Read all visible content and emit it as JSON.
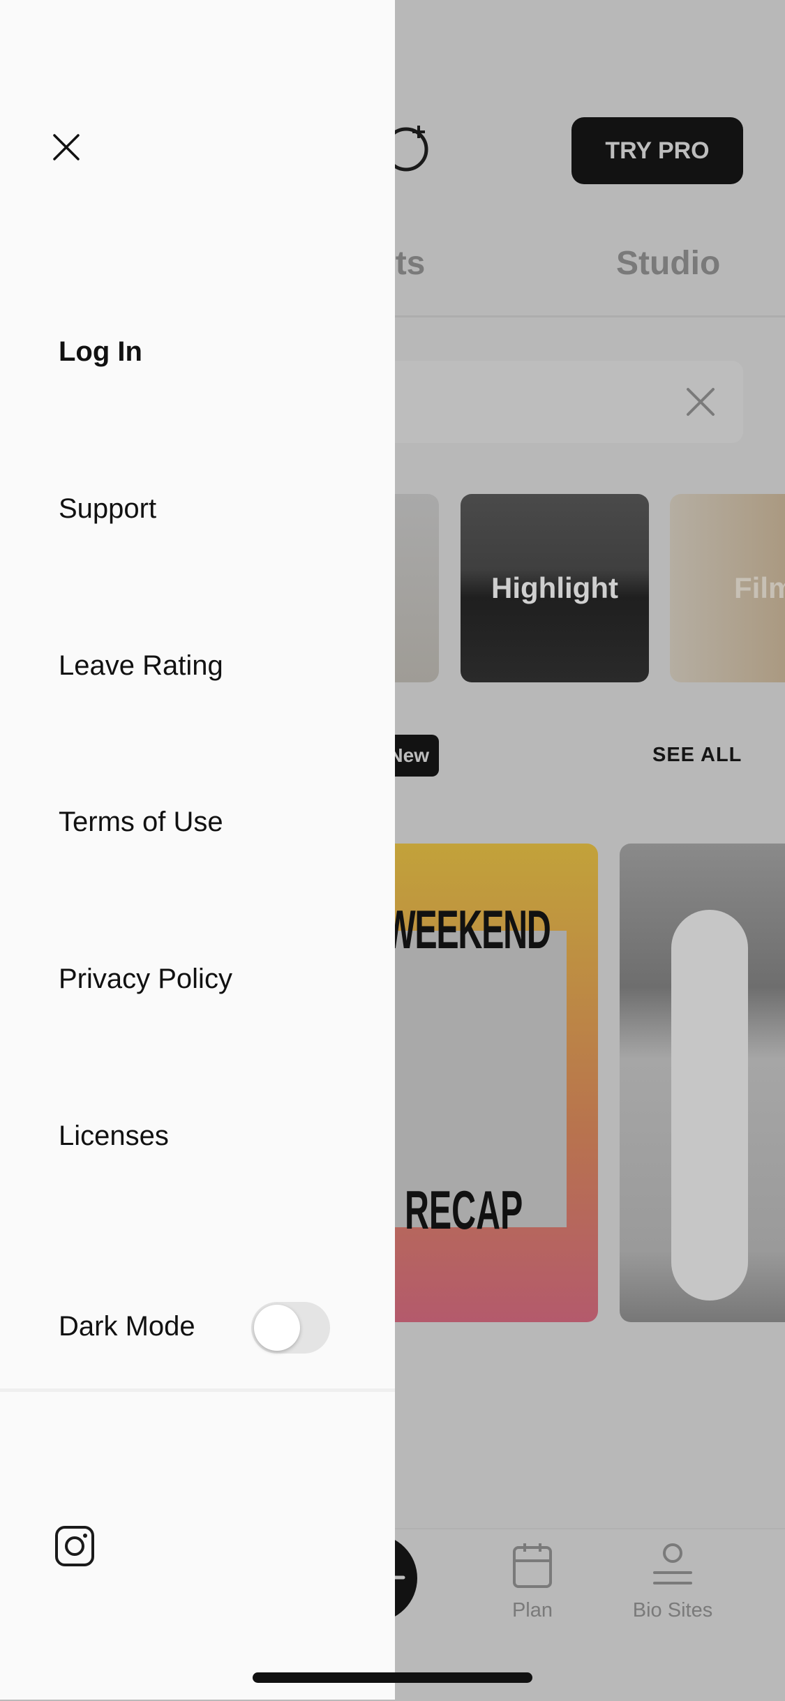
{
  "background": {
    "try_pro_label": "TRY PRO",
    "tabs": [
      {
        "label": "sts"
      },
      {
        "label": "Studio"
      }
    ],
    "categories": [
      {
        "label": ""
      },
      {
        "label": "Highlight"
      },
      {
        "label": "Film"
      }
    ],
    "new_badge": "New",
    "see_all_label": "SEE ALL",
    "template_card": {
      "top_text": "WEEKEND",
      "bottom_text": "RECAP"
    },
    "nav": [
      {
        "label": "Plan",
        "icon": "calendar-icon"
      },
      {
        "label": "Bio Sites",
        "icon": "profile-icon"
      }
    ]
  },
  "drawer": {
    "close_icon": "close-icon",
    "items": [
      {
        "label": "Log In"
      },
      {
        "label": "Support"
      },
      {
        "label": "Leave Rating"
      },
      {
        "label": "Terms of Use"
      },
      {
        "label": "Privacy Policy"
      },
      {
        "label": "Licenses"
      }
    ],
    "dark_mode": {
      "label": "Dark Mode",
      "enabled": false
    },
    "social_icon": "instagram-icon"
  },
  "colors": {
    "drawer_bg": "#fafafa",
    "overlay": "#b8b8b8",
    "button_dark": "#121212"
  }
}
